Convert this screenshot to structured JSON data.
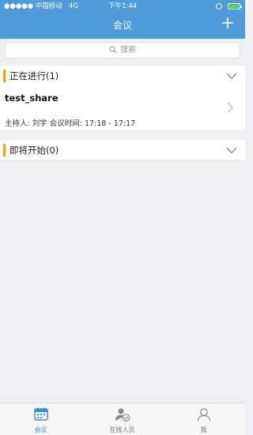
{
  "status_bar": {
    "carrier": "●●●●● 中国移动",
    "network": "4G",
    "time": "下午1:44"
  },
  "nav": {
    "title": "会议"
  },
  "search": {
    "placeholder": "搜索"
  },
  "sections": {
    "ongoing": {
      "title": "正在进行(1)"
    },
    "upcoming": {
      "title": "即将开始(0)"
    }
  },
  "meetings": [
    {
      "name": "test_share",
      "host": "主持人: 刘宇  会议时间: 17:18 - 17:17"
    }
  ],
  "tabs": [
    {
      "label": "会议",
      "icon": "calendar-icon",
      "active": true
    },
    {
      "label": "在线人员",
      "icon": "online-users-icon",
      "active": false
    },
    {
      "label": "我",
      "icon": "profile-icon",
      "active": false
    }
  ],
  "colors": {
    "header": "#4d9bd8",
    "accent_bar": "#f0a030",
    "active_tab": "#3a8fd6"
  }
}
